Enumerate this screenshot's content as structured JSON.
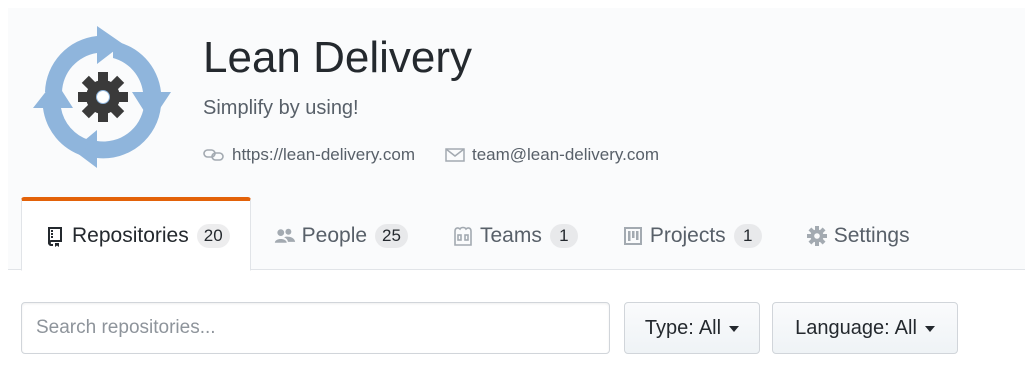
{
  "org": {
    "name": "Lean Delivery",
    "description": "Simplify by using!",
    "website": "https://lean-delivery.com",
    "email": "team@lean-delivery.com"
  },
  "tabs": [
    {
      "label": "Repositories",
      "count": "20",
      "icon": "repo-icon",
      "active": true
    },
    {
      "label": "People",
      "count": "25",
      "icon": "people-icon",
      "active": false
    },
    {
      "label": "Teams",
      "count": "1",
      "icon": "teams-icon",
      "active": false
    },
    {
      "label": "Projects",
      "count": "1",
      "icon": "projects-icon",
      "active": false
    },
    {
      "label": "Settings",
      "icon": "gear-icon",
      "active": false
    }
  ],
  "filters": {
    "search_placeholder": "Search repositories...",
    "type_prefix": "Type:",
    "type_value": "All",
    "language_prefix": "Language:",
    "language_value": "All"
  },
  "colors": {
    "active_tab_accent": "#e36209",
    "avatar_arrows": "#8fb5dc",
    "avatar_gear": "#3a3a3a"
  }
}
